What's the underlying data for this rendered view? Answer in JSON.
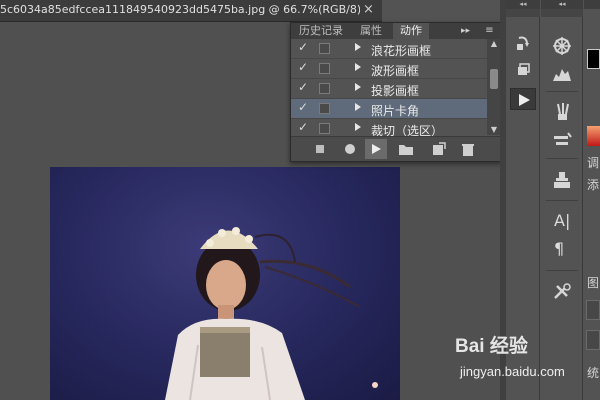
{
  "document": {
    "tab_title": "5c6034a85edfccea111849540923dd5475ba.jpg @ 66.7%(RGB/8)",
    "close_icon": "×"
  },
  "actions_panel": {
    "tabs": [
      {
        "label": "历史记录",
        "active": false
      },
      {
        "label": "属性",
        "active": false
      },
      {
        "label": "动作",
        "active": true
      }
    ],
    "forward_icon": "▸▸",
    "menu_icon": "≡",
    "actions": [
      {
        "label": "浪花形画框",
        "checked": true,
        "selected": false
      },
      {
        "label": "波形画框",
        "checked": true,
        "selected": false
      },
      {
        "label": "投影画框",
        "checked": true,
        "selected": false
      },
      {
        "label": "照片卡角",
        "checked": true,
        "selected": true
      },
      {
        "label": "裁切（选区）",
        "checked": true,
        "selected": false
      }
    ],
    "footer_buttons": [
      "stop-icon",
      "record-icon",
      "play-icon",
      "new-set-icon",
      "new-action-icon",
      "trash-icon"
    ]
  },
  "right_panels": {
    "collapse_icon": "◂◂",
    "far_labels": [
      "调",
      "添",
      "图",
      "统"
    ]
  },
  "watermark": {
    "brand": "Bai 经验",
    "url": "jingyan.baidu.com"
  },
  "colors": {
    "panel_bg": "#535353",
    "selected_row": "#5f6a7a",
    "image_bg": "#26275c"
  }
}
